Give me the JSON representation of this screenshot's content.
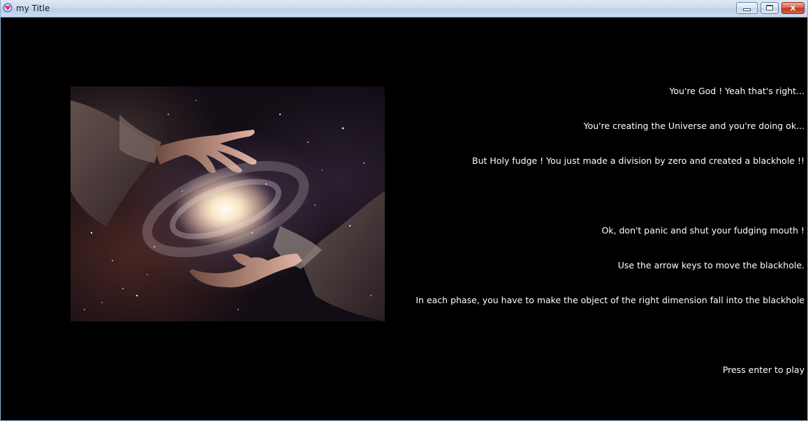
{
  "window": {
    "title": "my Title",
    "app_icon": "heart-shield-icon",
    "controls": {
      "minimize_icon": "minimize-icon",
      "maximize_icon": "maximize-icon",
      "close_glyph": "x"
    }
  },
  "game": {
    "image": {
      "subject": "hands-cradling-galaxy"
    },
    "intro_lines": [
      "You're God ! Yeah that's right...",
      "You're creating the Universe and you're doing ok...",
      "But Holy fudge ! You just made a division by zero and created a blackhole !!",
      "Ok, don't panic and shut your fudging mouth !",
      "Use the arrow keys to move the blackhole.",
      "In each phase, you have to make the object of the right dimension fall into the blackhole"
    ],
    "prompt": "Press enter to play"
  },
  "colors": {
    "background": "#000000",
    "text": "#ffffff",
    "titlebar": "#cddcee",
    "close_button": "#c4391f"
  }
}
